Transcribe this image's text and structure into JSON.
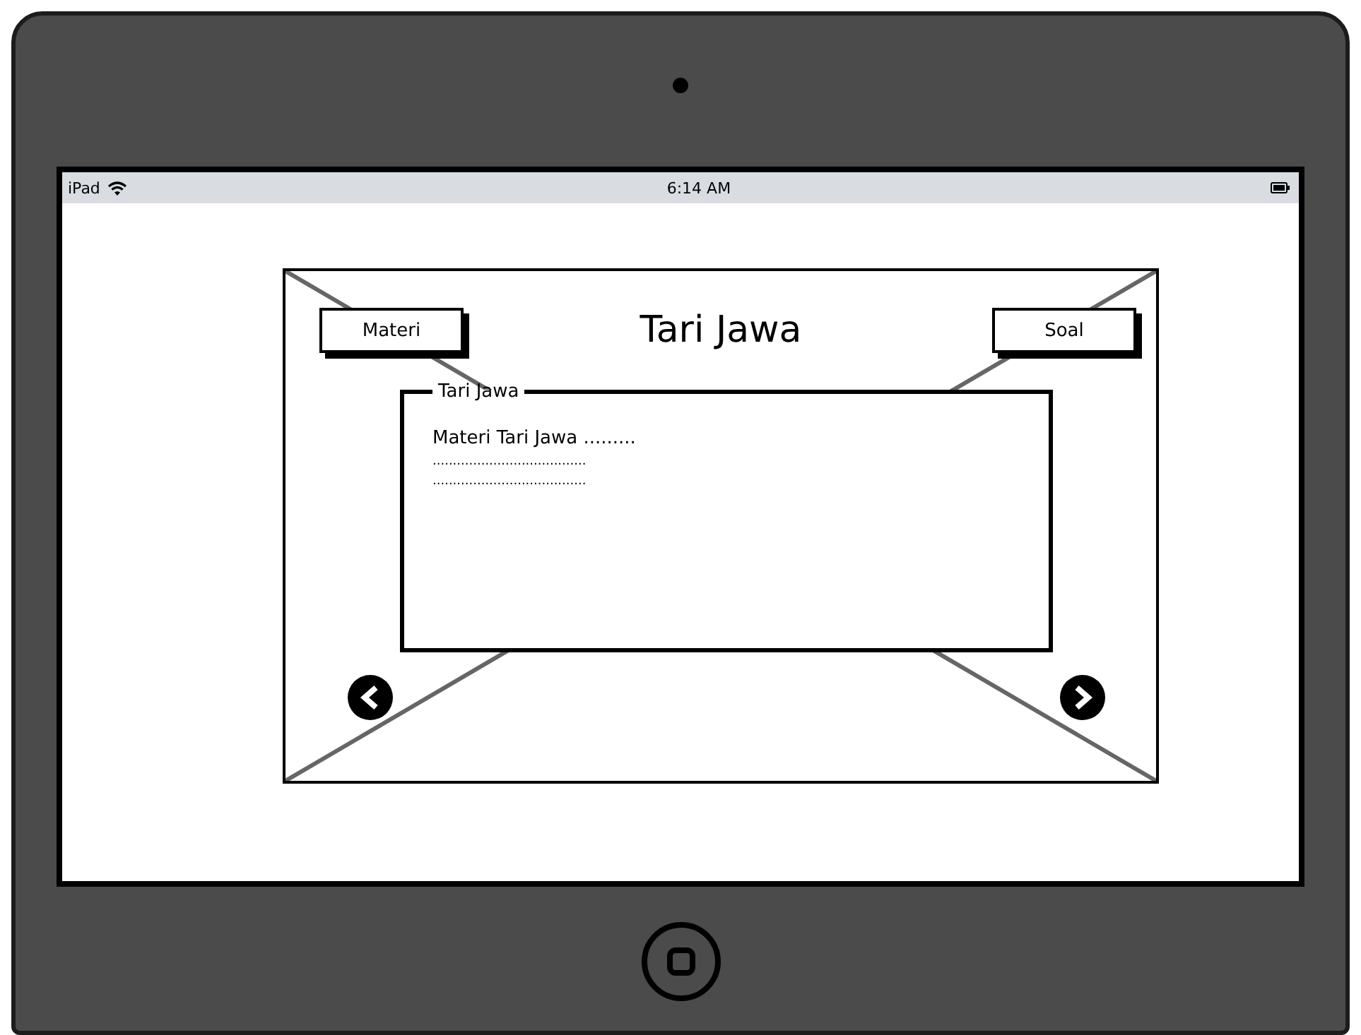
{
  "status_bar": {
    "device": "iPad",
    "time": "6:14 AM"
  },
  "buttons": [
    {
      "label": "Materi"
    },
    {
      "label": "Soal"
    }
  ],
  "title": "Tari Jawa",
  "panel": {
    "title": "Tari Jawa",
    "lines": [
      "Materi Tari Jawa .........",
      "......................................",
      "......................................"
    ]
  }
}
